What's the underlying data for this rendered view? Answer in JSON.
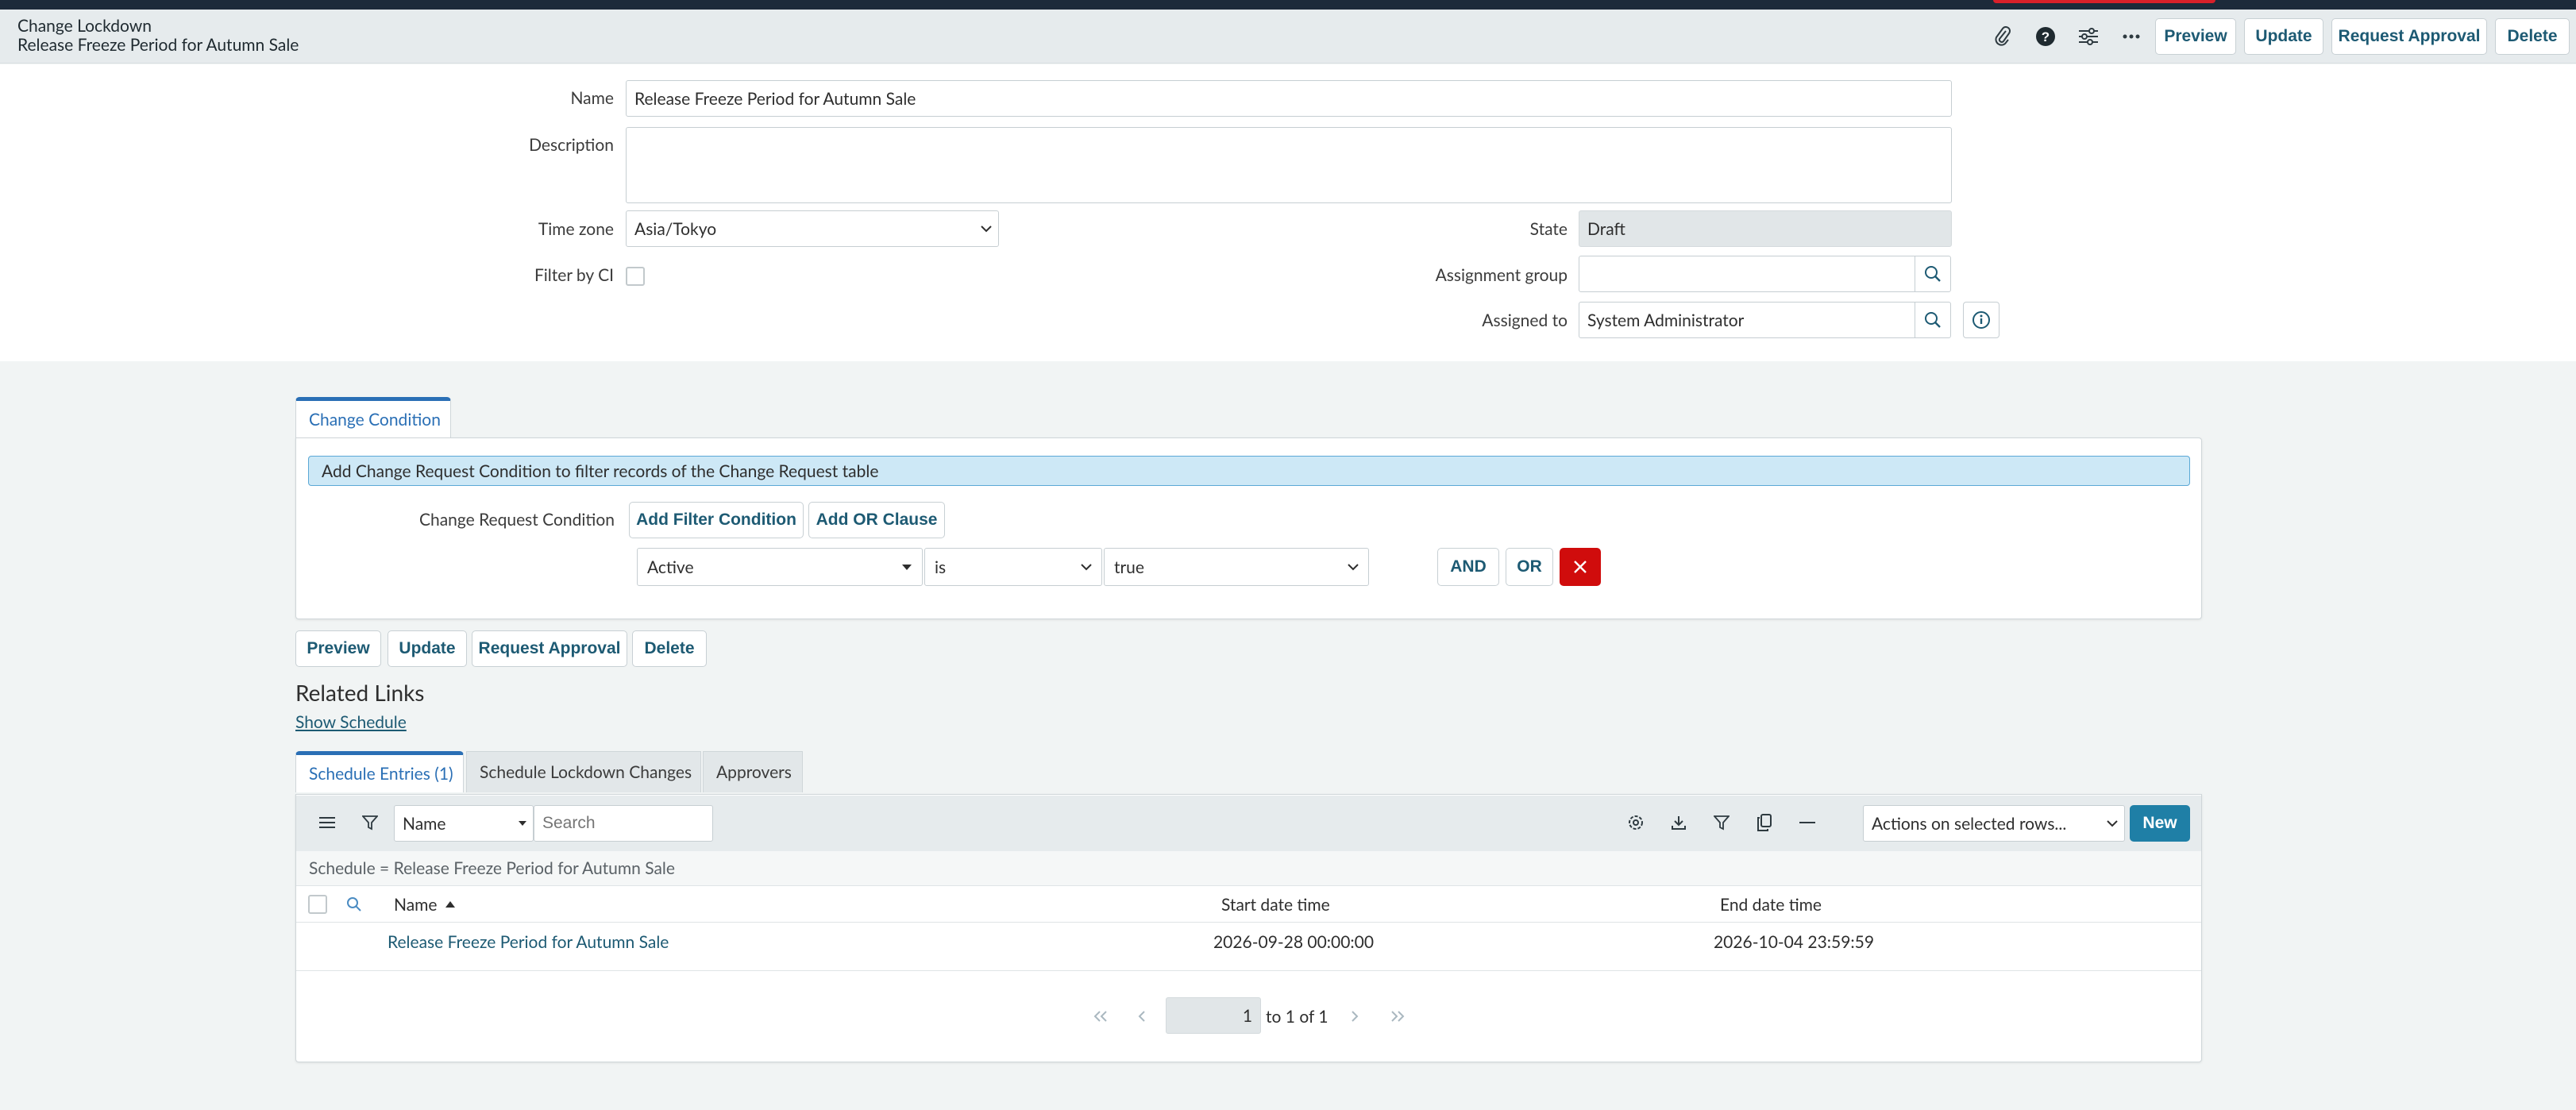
{
  "header": {
    "record_type": "Change Lockdown",
    "record_name": "Release Freeze Period for Autumn Sale",
    "buttons": {
      "preview": "Preview",
      "update": "Update",
      "request_approval": "Request Approval",
      "delete": "Delete"
    },
    "icons": [
      "paperclip-icon",
      "help-icon",
      "settings-sliders-icon",
      "more-icon"
    ]
  },
  "form": {
    "name_label": "Name",
    "name_value": "Release Freeze Period for Autumn Sale",
    "description_label": "Description",
    "description_value": "",
    "timezone_label": "Time zone",
    "timezone_value": "Asia/Tokyo",
    "filter_by_ci_label": "Filter by CI",
    "state_label": "State",
    "state_value": "Draft",
    "assignment_group_label": "Assignment group",
    "assignment_group_value": "",
    "assigned_to_label": "Assigned to",
    "assigned_to_value": "System Administrator"
  },
  "condition": {
    "tab_label": "Change Condition",
    "info_text": "Add Change Request Condition to filter records of the Change Request table",
    "condition_label": "Change Request Condition",
    "add_filter_label": "Add Filter Condition",
    "add_or_label": "Add OR Clause",
    "field_value": "Active",
    "operator_value": "is",
    "value_value": "true",
    "and_label": "AND",
    "or_label": "OR"
  },
  "bottom_buttons": {
    "preview": "Preview",
    "update": "Update",
    "request_approval": "Request Approval",
    "delete": "Delete"
  },
  "related_links": {
    "title": "Related Links",
    "show_schedule": "Show Schedule"
  },
  "related_list": {
    "tabs": [
      "Schedule Entries (1)",
      "Schedule Lockdown Changes",
      "Approvers"
    ],
    "search_field": "Name",
    "search_placeholder": "Search",
    "actions_placeholder": "Actions on selected rows...",
    "new_label": "New",
    "filter_breadcrumb": "Schedule = Release Freeze Period for Autumn Sale",
    "columns": [
      "Name",
      "Start date time",
      "End date time"
    ],
    "rows": [
      {
        "name": "Release Freeze Period for Autumn Sale",
        "start": "2026-09-28 00:00:00",
        "end": "2026-10-04 23:59:59"
      }
    ],
    "pager": {
      "current": "1",
      "text": "to 1 of 1"
    }
  },
  "colors": {
    "accent": "#2a6fb5",
    "link": "#1d5a73",
    "danger": "#d00c0c",
    "new_button": "#1f7fa6"
  }
}
